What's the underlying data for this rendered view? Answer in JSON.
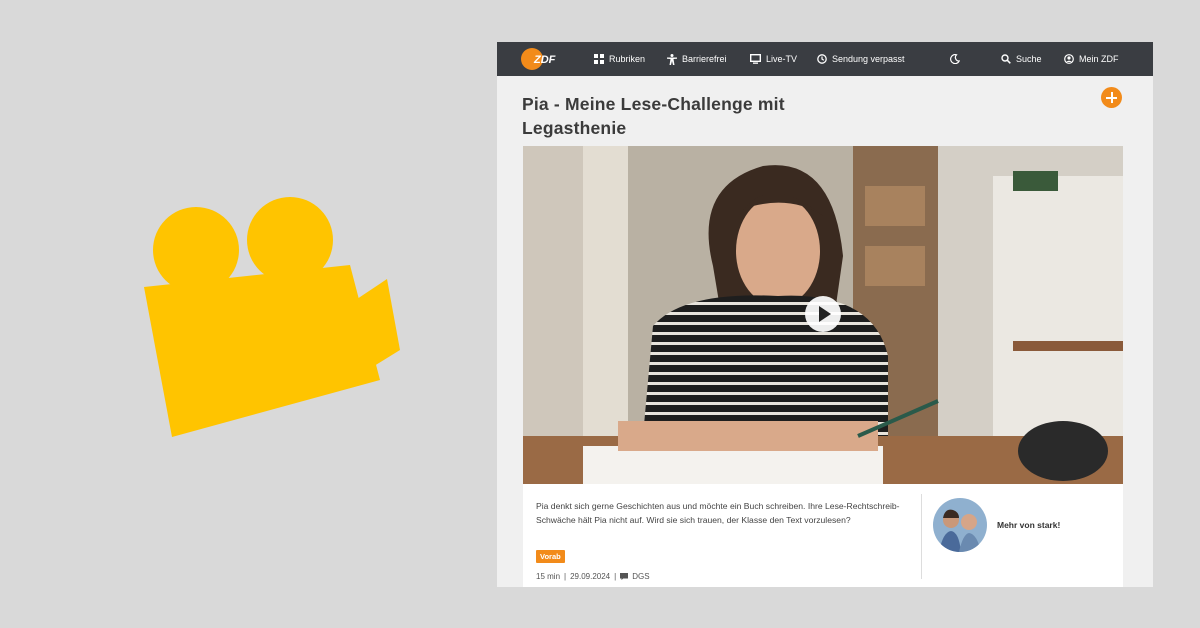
{
  "nav": {
    "items": [
      {
        "label": "Rubriken",
        "icon": "grid-icon"
      },
      {
        "label": "Barrierefrei",
        "icon": "accessibility-icon"
      },
      {
        "label": "Live-TV",
        "icon": "tv-icon"
      },
      {
        "label": "Sendung verpasst",
        "icon": "clock-icon"
      },
      {
        "label": "Suche",
        "icon": "search-icon"
      },
      {
        "label": "Mein ZDF",
        "icon": "user-icon"
      }
    ],
    "logo_text": "ZDF"
  },
  "video": {
    "title": "Pia - Meine Lese-Challenge mit Legasthenie",
    "description": "Pia denkt sich gerne Geschichten aus und möchte ein Buch schreiben. Ihre Lese-Rechtschreib-Schwäche hält Pia nicht auf. Wird sie sich trauen, der Klasse den Text vorzulesen?",
    "badge": "Vorab",
    "duration": "15 min",
    "date": "29.09.2024",
    "sign_language": "DGS"
  },
  "related": {
    "label": "Mehr von stark!"
  },
  "colors": {
    "accent": "#f28b1a",
    "camera_icon": "#ffc400",
    "nav_bg": "#3a3d42",
    "background": "#d9d9d9"
  }
}
